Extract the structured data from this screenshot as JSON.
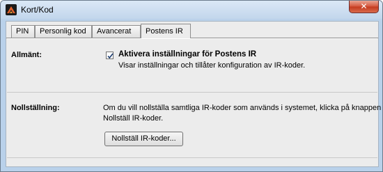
{
  "window": {
    "title": "Kort/Kod",
    "close_symbol": "✕"
  },
  "tabs": [
    {
      "label": "PIN",
      "active": false
    },
    {
      "label": "Personlig kod",
      "active": false
    },
    {
      "label": "Avancerat",
      "active": false
    },
    {
      "label": "Postens IR",
      "active": true
    }
  ],
  "general": {
    "label": "Allmänt:",
    "checkbox_label": "Aktivera inställningar för Postens IR",
    "checkbox_checked": true,
    "description": "Visar inställningar och tillåter konfiguration av IR-koder."
  },
  "reset": {
    "label": "Nollställning:",
    "line1": "Om du vill nollställa samtliga IR-koder som används i systemet, klicka på knappen",
    "line2": "Nollställ IR-koder.",
    "button_label": "Nollställ IR-koder..."
  },
  "icons": {
    "app": "app-logo-icon",
    "close": "close-icon",
    "check": "checkmark-icon"
  }
}
